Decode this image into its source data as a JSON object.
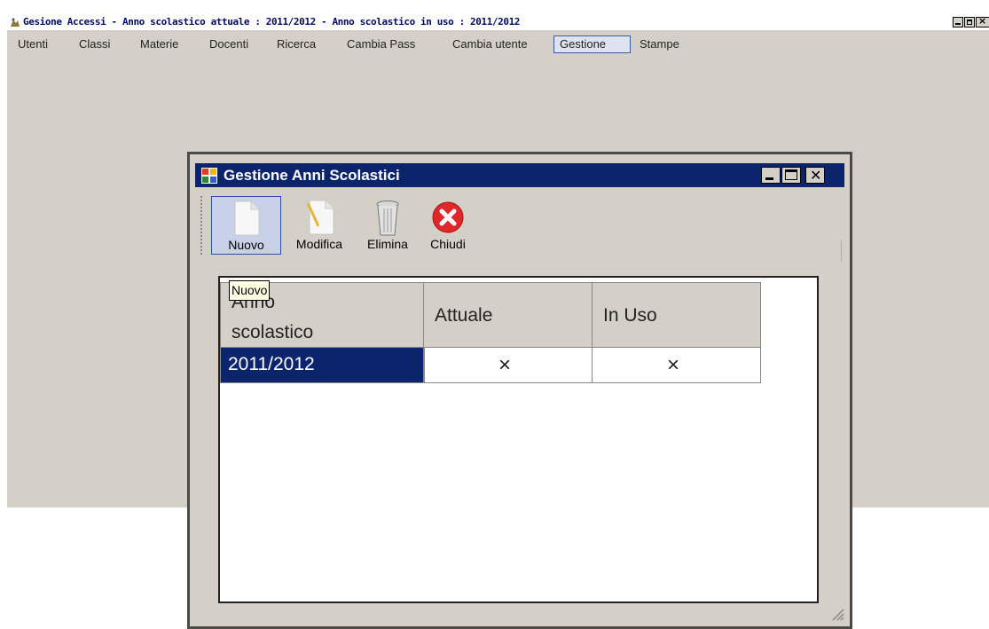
{
  "main_window": {
    "title": "Gesione Accessi - Anno scolastico attuale : 2011/2012 - Anno scolastico in uso : 2011/2012"
  },
  "menu": {
    "items": [
      "Utenti",
      "Classi",
      "Materie",
      "Docenti",
      "Ricerca",
      "Cambia Pass",
      "Cambia utente",
      "Gestione",
      "Stampe"
    ],
    "active": "Gestione"
  },
  "child_window": {
    "title": "Gestione Anni Scolastici"
  },
  "toolbar": {
    "buttons": [
      {
        "label": "Nuovo",
        "icon": "new-document-icon"
      },
      {
        "label": "Modifica",
        "icon": "edit-document-icon"
      },
      {
        "label": "Elimina",
        "icon": "trash-icon"
      },
      {
        "label": "Chiudi",
        "icon": "close-red-icon"
      }
    ]
  },
  "tooltip": "Nuovo",
  "grid": {
    "columns": [
      "Anno scolastico",
      "Attuale",
      "In Uso"
    ],
    "column_line1": "Anno",
    "column_line2": "scolastico",
    "rows": [
      {
        "anno": "2011/2012",
        "attuale": "×",
        "in_uso": "×"
      }
    ]
  },
  "colors": {
    "title_blue": "#0b246b",
    "window_gray": "#d4d0c8",
    "selection": "#0b246b",
    "tooltip_bg": "#ffffe1",
    "close_red": "#e0282a"
  }
}
